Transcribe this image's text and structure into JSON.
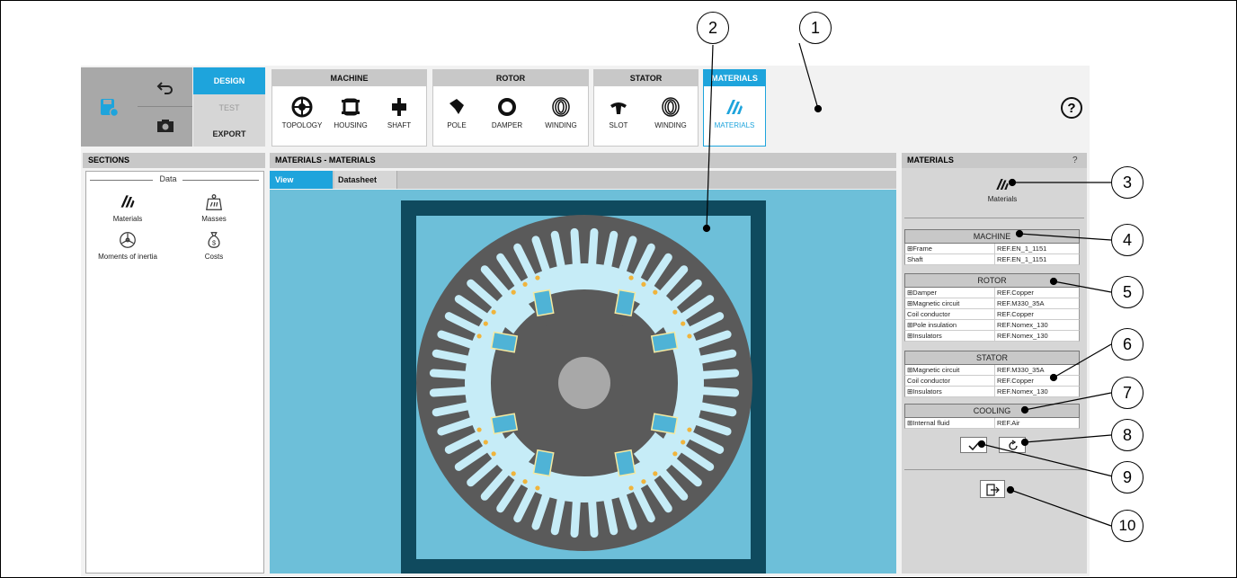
{
  "toolbar": {
    "design_label": "DESIGN",
    "test_label": "TEST",
    "export_label": "EXPORT",
    "groups": [
      {
        "title": "MACHINE",
        "items": [
          "TOPOLOGY",
          "HOUSING",
          "SHAFT"
        ]
      },
      {
        "title": "ROTOR",
        "items": [
          "POLE",
          "DAMPER",
          "WINDING"
        ]
      },
      {
        "title": "STATOR",
        "items": [
          "SLOT",
          "WINDING"
        ]
      },
      {
        "title": "MATERIALS",
        "items": [
          "MATERIALS"
        ]
      }
    ],
    "help_glyph": "?",
    "accent": "#1ea4dc"
  },
  "sections": {
    "title": "SECTIONS",
    "group_label": "Data",
    "items": [
      "Materials",
      "Masses",
      "Moments of inertia",
      "Costs"
    ]
  },
  "main": {
    "title": "MATERIALS - MATERIALS",
    "tabs": [
      "View",
      "Datasheet"
    ],
    "colors": {
      "background": "#6dbfd9",
      "frame": "#0f4a5e",
      "iron": "#5a5a5a",
      "slot": "#c6ecf7",
      "coil": "#4fb3d6",
      "dot": "#f0b43c"
    }
  },
  "panel": {
    "title": "MATERIALS",
    "help": "?",
    "icon_label": "Materials",
    "tables": [
      {
        "title": "MACHINE",
        "rows": [
          [
            "⊞Frame",
            "REF.EN_1_1151"
          ],
          [
            "Shaft",
            "REF.EN_1_1151"
          ]
        ]
      },
      {
        "title": "ROTOR",
        "rows": [
          [
            "⊞Damper",
            "REF.Copper"
          ],
          [
            "⊞Magnetic circuit",
            "REF.M330_35A"
          ],
          [
            "Coil conductor",
            "REF.Copper"
          ],
          [
            "⊞Pole insulation",
            "REF.Nomex_130"
          ],
          [
            "⊞Insulators",
            "REF.Nomex_130"
          ]
        ]
      },
      {
        "title": "STATOR",
        "rows": [
          [
            "⊞Magnetic circuit",
            "REF.M330_35A"
          ],
          [
            "Coil conductor",
            "REF.Copper"
          ],
          [
            "⊞Insulators",
            "REF.Nomex_130"
          ]
        ]
      },
      {
        "title": "COOLING",
        "rows": [
          [
            "⊞Internal fluid",
            "REF.Air"
          ]
        ]
      }
    ]
  },
  "callouts": [
    "1",
    "2",
    "3",
    "4",
    "5",
    "6",
    "7",
    "8",
    "9",
    "10"
  ]
}
